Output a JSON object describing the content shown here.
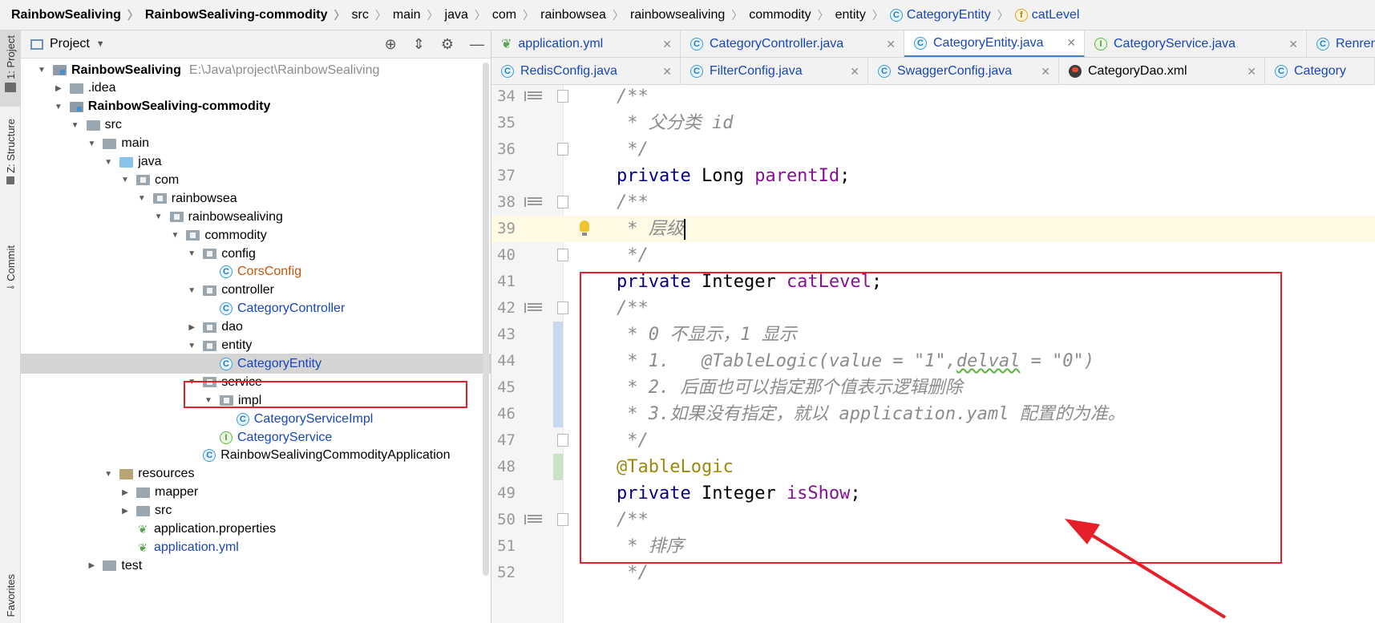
{
  "breadcrumb": [
    {
      "label": "RainbowSealiving",
      "bold": true,
      "icon": ""
    },
    {
      "label": "RainbowSealiving-commodity",
      "bold": true,
      "icon": ""
    },
    {
      "label": "src",
      "bold": false,
      "icon": ""
    },
    {
      "label": "main",
      "bold": false,
      "icon": ""
    },
    {
      "label": "java",
      "bold": false,
      "icon": ""
    },
    {
      "label": "com",
      "bold": false,
      "icon": ""
    },
    {
      "label": "rainbowsea",
      "bold": false,
      "icon": ""
    },
    {
      "label": "rainbowsealiving",
      "bold": false,
      "icon": ""
    },
    {
      "label": "commodity",
      "bold": false,
      "icon": ""
    },
    {
      "label": "entity",
      "bold": false,
      "icon": ""
    },
    {
      "label": "CategoryEntity",
      "bold": false,
      "icon": "class",
      "blue": true
    },
    {
      "label": "catLevel",
      "bold": false,
      "icon": "field",
      "blue": true
    }
  ],
  "toolstrip": {
    "project": "1: Project",
    "structure": "Z: Structure",
    "commit": "Commit",
    "favorites": "Favorites"
  },
  "project_panel": {
    "title": "Project",
    "tree": [
      {
        "label": "RainbowSealiving",
        "path": "E:\\Java\\project\\RainbowSealiving",
        "indent": 0,
        "arrow": "open",
        "icon": "module",
        "bold": true
      },
      {
        "label": ".idea",
        "indent": 1,
        "arrow": "closed",
        "icon": "folder"
      },
      {
        "label": "RainbowSealiving-commodity",
        "indent": 1,
        "arrow": "open",
        "icon": "module",
        "bold": true
      },
      {
        "label": "src",
        "indent": 2,
        "arrow": "open",
        "icon": "folder"
      },
      {
        "label": "main",
        "indent": 3,
        "arrow": "open",
        "icon": "folder"
      },
      {
        "label": "java",
        "indent": 4,
        "arrow": "open",
        "icon": "folder-blue"
      },
      {
        "label": "com",
        "indent": 5,
        "arrow": "open",
        "icon": "package"
      },
      {
        "label": "rainbowsea",
        "indent": 6,
        "arrow": "open",
        "icon": "package"
      },
      {
        "label": "rainbowsealiving",
        "indent": 7,
        "arrow": "open",
        "icon": "package"
      },
      {
        "label": "commodity",
        "indent": 8,
        "arrow": "open",
        "icon": "package"
      },
      {
        "label": "config",
        "indent": 9,
        "arrow": "open",
        "icon": "package"
      },
      {
        "label": "CorsConfig",
        "indent": 10,
        "arrow": "none",
        "icon": "class",
        "color": "orange"
      },
      {
        "label": "controller",
        "indent": 9,
        "arrow": "open",
        "icon": "package"
      },
      {
        "label": "CategoryController",
        "indent": 10,
        "arrow": "none",
        "icon": "class",
        "color": "blue"
      },
      {
        "label": "dao",
        "indent": 9,
        "arrow": "closed",
        "icon": "package"
      },
      {
        "label": "entity",
        "indent": 9,
        "arrow": "open",
        "icon": "package"
      },
      {
        "label": "CategoryEntity",
        "indent": 10,
        "arrow": "none",
        "icon": "class",
        "color": "blue",
        "selected": true
      },
      {
        "label": "service",
        "indent": 9,
        "arrow": "open",
        "icon": "package"
      },
      {
        "label": "impl",
        "indent": 10,
        "arrow": "open",
        "icon": "package"
      },
      {
        "label": "CategoryServiceImpl",
        "indent": 11,
        "arrow": "none",
        "icon": "class",
        "color": "blue"
      },
      {
        "label": "CategoryService",
        "indent": 10,
        "arrow": "none",
        "icon": "interface",
        "color": "blue"
      },
      {
        "label": "RainbowSealivingCommodityApplication",
        "indent": 9,
        "arrow": "none",
        "icon": "app"
      },
      {
        "label": "resources",
        "indent": 4,
        "arrow": "open",
        "icon": "resources"
      },
      {
        "label": "mapper",
        "indent": 5,
        "arrow": "closed",
        "icon": "folder"
      },
      {
        "label": "src",
        "indent": 5,
        "arrow": "closed",
        "icon": "folder"
      },
      {
        "label": "application.properties",
        "indent": 5,
        "arrow": "none",
        "icon": "leaf"
      },
      {
        "label": "application.yml",
        "indent": 5,
        "arrow": "none",
        "icon": "leaf",
        "color": "blue"
      },
      {
        "label": "test",
        "indent": 3,
        "arrow": "closed",
        "icon": "folder"
      }
    ]
  },
  "editor_tabs": {
    "row1": [
      {
        "label": "application.yml",
        "icon": "yml"
      },
      {
        "label": "CategoryController.java",
        "icon": "class"
      },
      {
        "label": "CategoryEntity.java",
        "icon": "class",
        "active": true
      },
      {
        "label": "CategoryService.java",
        "icon": "interface"
      },
      {
        "label": "Renren",
        "icon": "app"
      }
    ],
    "row2": [
      {
        "label": "RedisConfig.java",
        "icon": "class"
      },
      {
        "label": "FilterConfig.java",
        "icon": "class"
      },
      {
        "label": "SwaggerConfig.java",
        "icon": "class"
      },
      {
        "label": "CategoryDao.xml",
        "icon": "xml"
      },
      {
        "label": "Category",
        "icon": "class"
      }
    ]
  },
  "code_lines": [
    {
      "n": "34",
      "text": "/**",
      "kind": "cmt",
      "fold": "list"
    },
    {
      "n": "35",
      "text": " * 父分类 id",
      "kind": "cmt"
    },
    {
      "n": "36",
      "text": " */",
      "kind": "cmt",
      "foldEnd": true
    },
    {
      "n": "37",
      "parts": [
        [
          "private ",
          "kw"
        ],
        [
          "Long ",
          "type"
        ],
        [
          "parentId",
          "fld"
        ],
        [
          ";",
          "type"
        ]
      ]
    },
    {
      "n": "38",
      "text": "/**",
      "kind": "cmt",
      "fold": "list"
    },
    {
      "n": "39",
      "text": " * 层级",
      "kind": "cmt",
      "current": true,
      "bulb": true
    },
    {
      "n": "40",
      "text": " */",
      "kind": "cmt",
      "foldEnd": true
    },
    {
      "n": "41",
      "parts": [
        [
          "private ",
          "kw"
        ],
        [
          "Integer ",
          "type"
        ],
        [
          "catLevel",
          "fld"
        ],
        [
          ";",
          "type"
        ]
      ]
    },
    {
      "n": "42",
      "text": "/**",
      "kind": "cmt",
      "fold": "list"
    },
    {
      "n": "43",
      "text": " * 0 不显示，1 显示",
      "kind": "cmt",
      "change": "mod"
    },
    {
      "n": "44",
      "parts": [
        [
          " * 1.   @TableLogic(value = \"1\",",
          "cmt"
        ],
        [
          "delval",
          "cmt-sq"
        ],
        [
          " = \"0\")",
          "cmt"
        ]
      ],
      "change": "mod"
    },
    {
      "n": "45",
      "text": " * 2. 后面也可以指定那个值表示逻辑删除",
      "kind": "cmt",
      "change": "mod"
    },
    {
      "n": "46",
      "text": " * 3.如果没有指定，就以 application.yaml 配置的为准。",
      "kind": "cmt",
      "change": "mod"
    },
    {
      "n": "47",
      "text": " */",
      "kind": "cmt",
      "foldEnd": true
    },
    {
      "n": "48",
      "text": "@TableLogic",
      "kind": "ann",
      "change": "add"
    },
    {
      "n": "49",
      "parts": [
        [
          "private ",
          "kw"
        ],
        [
          "Integer ",
          "type"
        ],
        [
          "isShow",
          "fld"
        ],
        [
          ";",
          "type"
        ]
      ]
    },
    {
      "n": "50",
      "text": "/**",
      "kind": "cmt",
      "fold": "list"
    },
    {
      "n": "51",
      "text": " * 排序",
      "kind": "cmt"
    },
    {
      "n": "52",
      "text": " */",
      "kind": "cmt"
    }
  ],
  "colors": {
    "highlight_red": "#e5202a",
    "selection": "#d4d4d4",
    "keyword": "#000080",
    "field": "#871094",
    "comment": "#8c8c8c",
    "annotation": "#9e880d"
  }
}
